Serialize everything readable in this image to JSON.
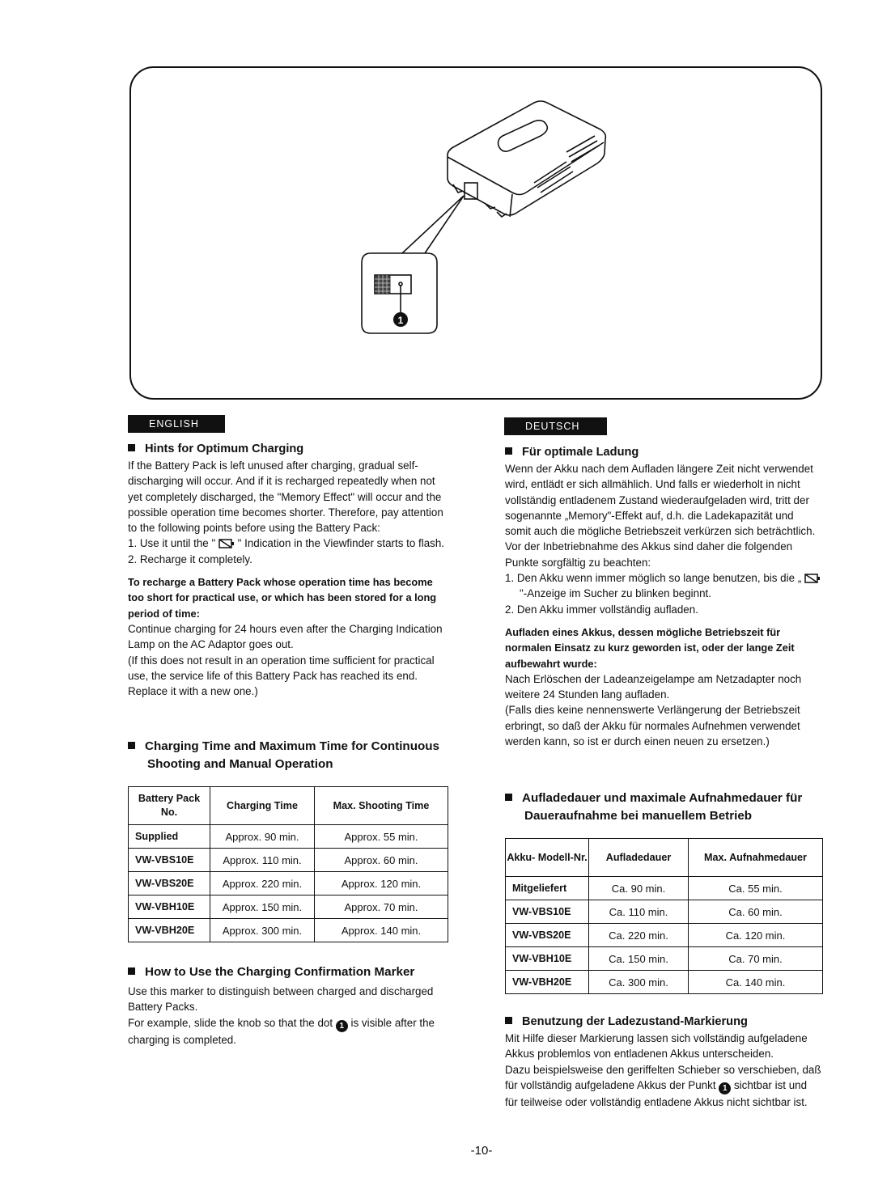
{
  "figure": {
    "callout": "1"
  },
  "english": {
    "tab": "ENGLISH",
    "hints": {
      "title": "Hints for Optimum Charging",
      "body": "If the Battery Pack is left unused after charging, gradual self-discharging will occur. And if it is recharged repeatedly when not yet completely discharged, the \"Memory Effect\" will occur and the possible operation time becomes shorter. Therefore, pay attention to the following points before using the Battery Pack:",
      "item1_pre": "1.  Use it until the \" ",
      "item1_post": " \" Indication in the Viewfinder starts to flash.",
      "item2": "2.  Recharge it completely.",
      "bold": "To recharge a Battery Pack whose operation time has become too short for practical use, or which has been stored for a long period of time:",
      "p2": "Continue charging for 24 hours even after the Charging Indication Lamp on the AC Adaptor goes out.",
      "p3": "(If this does not result in an operation time sufficient for practical use, the service life of this Battery Pack has reached its end. Replace it with a new one.)"
    },
    "charging": {
      "title": "Charging Time and Maximum Time for Continuous Shooting and Manual Operation",
      "headers": [
        "Battery Pack No.",
        "Charging Time",
        "Max. Shooting Time"
      ],
      "rows": [
        [
          "Supplied",
          "Approx. 90 min.",
          "Approx. 55 min."
        ],
        [
          "VW-VBS10E",
          "Approx. 110 min.",
          "Approx. 60 min."
        ],
        [
          "VW-VBS20E",
          "Approx. 220 min.",
          "Approx. 120 min."
        ],
        [
          "VW-VBH10E",
          "Approx. 150 min.",
          "Approx. 70 min."
        ],
        [
          "VW-VBH20E",
          "Approx. 300 min.",
          "Approx. 140 min."
        ]
      ]
    },
    "marker": {
      "title": "How to Use the Charging Confirmation Marker",
      "p1": "Use this marker to distinguish between charged and discharged Battery Packs.",
      "p2_pre": "For example, slide the knob so that the dot ",
      "p2_post": " is visible after the charging is completed."
    }
  },
  "deutsch": {
    "tab": "DEUTSCH",
    "hints": {
      "title": "Für optimale Ladung",
      "body": "Wenn der Akku nach dem Aufladen längere Zeit nicht verwendet wird, entlädt er sich allmählich. Und falls er wiederholt in nicht vollständig entladenem Zustand wiederaufgeladen wird, tritt der sogenannte „Memory\"-Effekt auf, d.h. die Ladekapazität und somit auch die mögliche Betriebszeit verkürzen sich beträchtlich. Vor der Inbetriebnahme des Akkus sind daher die folgenden Punkte sorgfältig zu beachten:",
      "item1_pre": "1.  Den Akku wenn immer möglich so lange benutzen, bis die „ ",
      "item1_post": " \"-Anzeige im Sucher zu blinken beginnt.",
      "item2": "2.  Den Akku immer vollständig aufladen.",
      "bold": "Aufladen eines Akkus, dessen mögliche Betriebszeit für normalen Einsatz zu kurz geworden ist, oder der lange Zeit aufbewahrt wurde:",
      "p2": "Nach Erlöschen der Ladeanzeigelampe am Netzadapter noch weitere 24 Stunden lang aufladen.",
      "p3": "(Falls dies keine nennenswerte Verlängerung der Betriebszeit erbringt, so daß der Akku für normales Aufnehmen verwendet werden kann, so ist er durch einen neuen zu ersetzen.)"
    },
    "charging": {
      "title": "Aufladedauer und maximale Aufnahmedauer für Daueraufnahme bei manuellem Betrieb",
      "headers": [
        "Akku- Modell-Nr.",
        "Aufladedauer",
        "Max. Aufnahmedauer"
      ],
      "rows": [
        [
          "Mitgeliefert",
          "Ca. 90 min.",
          "Ca. 55 min."
        ],
        [
          "VW-VBS10E",
          "Ca. 110 min.",
          "Ca. 60 min."
        ],
        [
          "VW-VBS20E",
          "Ca. 220 min.",
          "Ca. 120 min."
        ],
        [
          "VW-VBH10E",
          "Ca. 150 min.",
          "Ca. 70 min."
        ],
        [
          "VW-VBH20E",
          "Ca. 300 min.",
          "Ca. 140 min."
        ]
      ]
    },
    "marker": {
      "title": "Benutzung der Ladezustand-Markierung",
      "p1": "Mit Hilfe dieser Markierung lassen sich vollständig aufgeladene Akkus problemlos von entladenen Akkus unterscheiden.",
      "p2_pre": "Dazu beispielsweise den geriffelten Schieber so verschieben, daß für vollständig aufgeladene Akkus der Punkt ",
      "p2_post": " sichtbar ist und für teilweise oder vollständig entladene Akkus nicht sichtbar ist."
    }
  },
  "page_number": "-10-"
}
